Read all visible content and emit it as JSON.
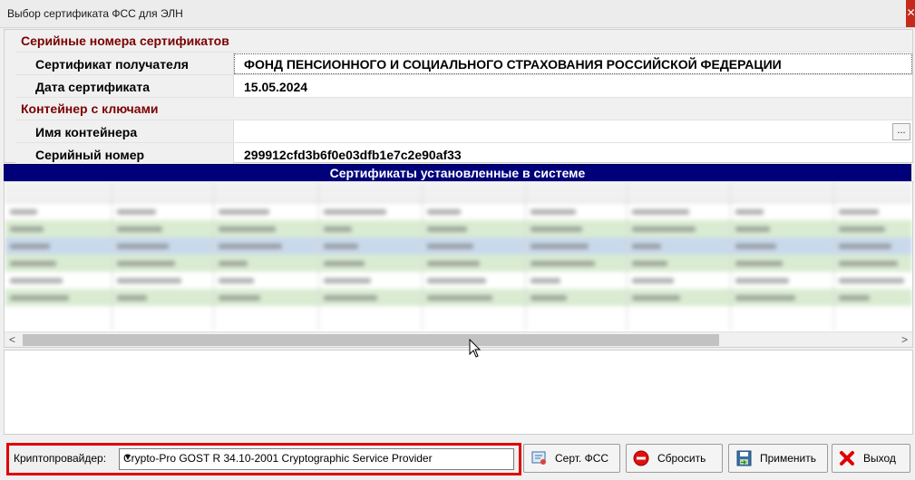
{
  "window": {
    "title": "Выбор сертификата ФСС для ЭЛН",
    "close_glyph": "✕"
  },
  "properties": {
    "section_serials": "Серийные номера сертификатов",
    "recipient_label": "Сертификат получателя",
    "recipient_value": "ФОНД ПЕНСИОННОГО И СОЦИАЛЬНОГО СТРАХОВАНИЯ РОССИЙСКОЙ ФЕДЕРАЦИИ",
    "date_label": "Дата сертификата",
    "date_value": "15.05.2024",
    "section_container": "Контейнер с ключами",
    "container_label": "Имя контейнера",
    "container_value": "",
    "container_browse": "...",
    "serial_label": "Серийный номер",
    "serial_value": "299912cfd3b6f0e03dfb1e7c2e90af33"
  },
  "grid": {
    "title": "Сертификаты установленные в системе",
    "row_colors": [
      "white",
      "green",
      "blue",
      "green",
      "white",
      "green"
    ],
    "scroll_left": "<",
    "scroll_right": ">"
  },
  "bottom": {
    "provider_label": "Криптопровайдер:",
    "provider_value": "Crypto-Pro GOST R 34.10-2001 Cryptographic Service Provider",
    "btn_cert": "Серт. ФСС",
    "btn_reset": "Сбросить",
    "btn_apply": "Применить",
    "btn_exit": "Выход"
  },
  "colors": {
    "accent_red": "#e00000",
    "header_navy": "#00007a",
    "category_text": "#7a0000"
  }
}
